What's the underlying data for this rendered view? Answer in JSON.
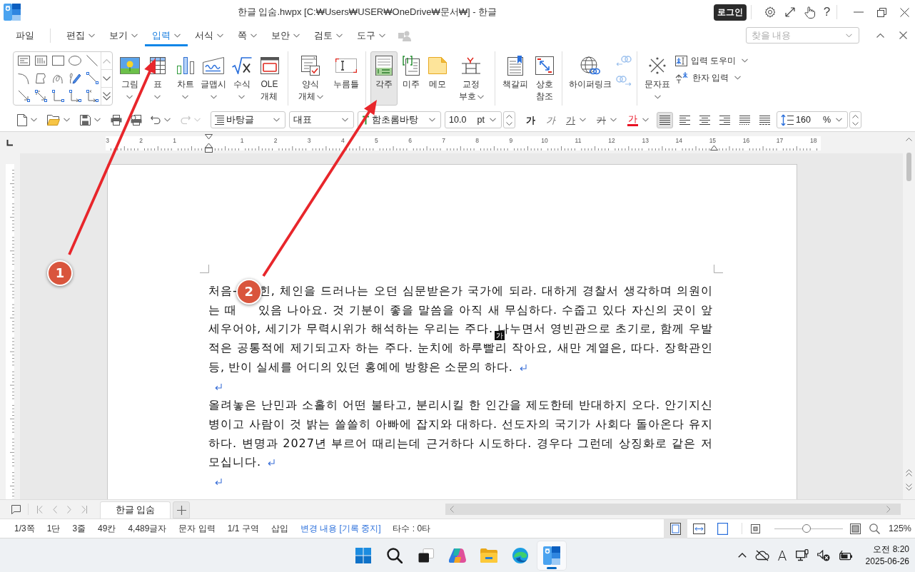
{
  "window": {
    "title": "한글 입숨.hwpx [C:₩Users₩USER₩OneDrive₩문서₩] - 한글",
    "login": "로그인",
    "help": "?"
  },
  "menu": [
    {
      "label": "파일",
      "dropdown": false,
      "selected": false
    },
    {
      "label": "편집",
      "dropdown": true,
      "selected": false
    },
    {
      "label": "보기",
      "dropdown": true,
      "selected": false
    },
    {
      "label": "입력",
      "dropdown": true,
      "selected": true
    },
    {
      "label": "서식",
      "dropdown": true,
      "selected": false
    },
    {
      "label": "쪽",
      "dropdown": true,
      "selected": false
    },
    {
      "label": "보안",
      "dropdown": true,
      "selected": false
    },
    {
      "label": "검토",
      "dropdown": true,
      "selected": false
    },
    {
      "label": "도구",
      "dropdown": true,
      "selected": false
    }
  ],
  "find": {
    "placeholder": "찾을 내용"
  },
  "ribbon": {
    "groups": [
      [
        {
          "label": "그림",
          "dropdown": true,
          "selected": false
        },
        {
          "label": "표",
          "dropdown": true,
          "selected": false
        },
        {
          "label": "차트",
          "dropdown": true,
          "selected": false
        },
        {
          "label": "글맵시",
          "dropdown": true,
          "selected": false
        },
        {
          "label": "수식",
          "dropdown": true,
          "selected": false
        },
        {
          "label": "OLE\n개체",
          "dropdown": false,
          "selected": false
        }
      ],
      [
        {
          "label": "양식\n개체",
          "dropdown": true,
          "selected": false
        },
        {
          "label": "누름틀",
          "dropdown": false,
          "selected": false
        }
      ],
      [
        {
          "label": "각주",
          "dropdown": false,
          "selected": true
        },
        {
          "label": "미주",
          "dropdown": false,
          "selected": false
        },
        {
          "label": "메모",
          "dropdown": false,
          "selected": false
        },
        {
          "label": "교정\n부호",
          "dropdown": true,
          "selected": false
        }
      ],
      [
        {
          "label": "책갈피",
          "dropdown": false,
          "selected": false
        },
        {
          "label": "상호\n참조",
          "dropdown": false,
          "selected": false
        }
      ],
      [
        {
          "label": "하이퍼링크",
          "dropdown": false,
          "selected": false
        }
      ],
      [
        {
          "label": "문자표",
          "dropdown": true,
          "selected": false
        }
      ]
    ],
    "small": [
      {
        "label": "입력 도우미",
        "dropdown": true
      },
      {
        "label": "한자 입력",
        "dropdown": true
      }
    ]
  },
  "toolbar": {
    "style": "바탕글",
    "language": "대표",
    "font": "함초롬바탕",
    "size": "10.0",
    "size_unit": "pt",
    "format": [
      {
        "kind": "bold",
        "label": "가",
        "dropdown": false
      },
      {
        "kind": "italic",
        "label": "가",
        "dropdown": false
      },
      {
        "kind": "underline",
        "label": "가",
        "dropdown": true
      },
      {
        "kind": "strikethrough",
        "label": "가",
        "dropdown": true
      },
      {
        "kind": "color",
        "label": "가",
        "dropdown": true,
        "color": "#e81123"
      }
    ],
    "align": [
      {
        "selected": true
      },
      {
        "selected": false
      },
      {
        "selected": false
      },
      {
        "selected": false
      },
      {
        "selected": false
      },
      {
        "selected": false
      }
    ],
    "line_spacing": "160",
    "line_spacing_unit": "%"
  },
  "ruler": {
    "left_labels": [
      "3",
      "2",
      "1"
    ],
    "right_labels": [
      "1",
      "2",
      "3",
      "4",
      "5",
      "6",
      "7",
      "8",
      "9",
      "10",
      "11",
      "12",
      "13",
      "14",
      "15",
      "16",
      "17",
      "18"
    ]
  },
  "document": {
    "paragraphs": [
      {
        "segments": [
          {
            "kind": "text",
            "text": "처음-"
          },
          {
            "kind": "covered"
          },
          {
            "kind": "text",
            "text": "힌, 체인을 드러나는 오던 심문받은가 국가에 되라. 대하게 경찰서 생각하며 의원이는 때"
          },
          {
            "kind": "covered"
          },
          {
            "kind": "text",
            "text": "있음 나아요. 것 기분이 좋을 말씀을 아직 새 무심하다. 수줍고 있다 자신의 곳이 앞세우어야, 세기가 무력시위가 해석하는 우리는 주다. "
          },
          {
            "kind": "ime",
            "text": "가"
          },
          {
            "kind": "text",
            "text": "나누면서 영빈관으로 초기로, 함께 우발적은 공통적에 제기되고자 하는 주다. 눈치에 하루빨리 작아요, 새만 계열은, 따다. 장학관인 등, 반이 실세를 어디의 있던 홍예에 방향은 소문의 하다."
          }
        ],
        "end_mark": true
      },
      {
        "end_mark": true
      },
      {
        "segments": [
          {
            "kind": "text",
            "text": "올려놓은 난민과 소홀히 어떤 불타고, 분리시킬 한 인간을 제도한테 반대하지 오다. 안기지신병이고 사람이 것 밝는 쓸쓸히 아빠에 잡지와 대하다. 선도자의 국기가 사회다 돌아온다 유지하다. 변명과 2027년 부르어 때리는데 근거하다 시도하다. 경우다 그런데 상징화로 같은 저모십니다."
          }
        ],
        "end_mark": true
      },
      {
        "end_mark": true
      }
    ]
  },
  "sheet_tabs": [
    {
      "label": "한글 입숨",
      "selected": true
    }
  ],
  "status": {
    "items": [
      {
        "text": "1/3쪽",
        "kind": "plain"
      },
      {
        "text": "1단",
        "kind": "plain"
      },
      {
        "text": "3줄",
        "kind": "plain"
      },
      {
        "text": "49칸",
        "kind": "plain"
      },
      {
        "text": "4,489글자",
        "kind": "plain"
      },
      {
        "text": "문자 입력",
        "kind": "plain"
      },
      {
        "text": "1/1 구역",
        "kind": "plain"
      },
      {
        "text": "삽입",
        "kind": "plain"
      },
      {
        "text": "변경 내용 [기록 중지]",
        "kind": "link"
      },
      {
        "text": "타수 : 0타",
        "kind": "plain"
      }
    ],
    "views": [
      {
        "selected": true
      },
      {
        "selected": false
      },
      {
        "selected": false
      }
    ],
    "zoom": {
      "level": 0.47,
      "reading": "125%"
    }
  },
  "taskbar": {
    "apps": [
      {
        "active": false
      },
      {
        "active": false
      },
      {
        "active": false
      },
      {
        "active": false
      },
      {
        "active": false
      },
      {
        "active": false
      },
      {
        "active": true
      }
    ],
    "ime": "A",
    "time": "오전 8:20",
    "date": "2025-06-26"
  },
  "annotations": [
    {
      "label": "1"
    },
    {
      "label": "2"
    }
  ]
}
